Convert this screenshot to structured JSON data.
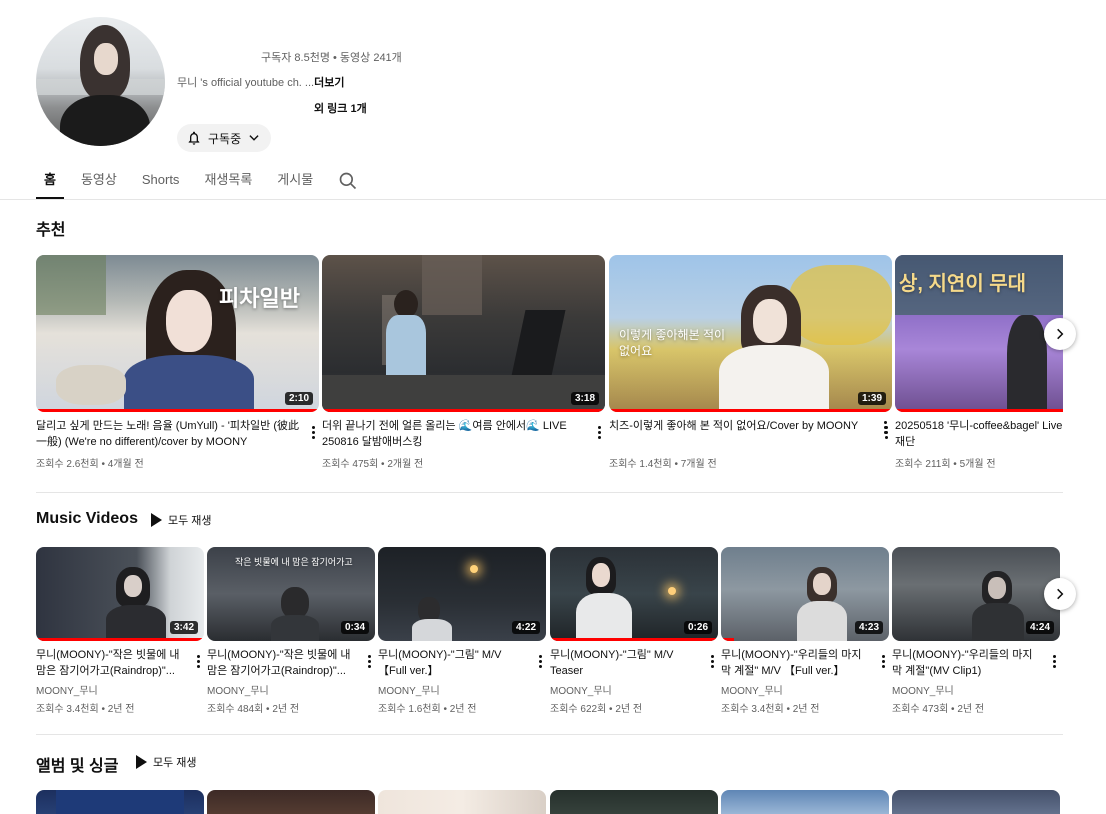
{
  "channel": {
    "subscribers": "구독자 8.5천명 • 동영상 241개",
    "description": "무니 's official youtube ch. ...",
    "more_label": "더보기",
    "links": "외 링크 1개",
    "subscribe_label": "구독중"
  },
  "tabs": [
    {
      "label": "홈",
      "active": true
    },
    {
      "label": "동영상"
    },
    {
      "label": "Shorts"
    },
    {
      "label": "재생목록"
    },
    {
      "label": "게시물"
    }
  ],
  "shelves": {
    "recommended": {
      "title": "추천",
      "videos": [
        {
          "title": "달리고 싶게 만드는 노래! 음율 (UmYull) - '피차일반 (彼此一般) (We're no different)/cover by MOONY",
          "meta": "조회수 2.6천회 • 4개월 전",
          "duration": "2:10",
          "overlay": "피차일반",
          "progress": 1.0
        },
        {
          "title": "더위 끝나기 전에 얼른 올리는 🌊여름 안에서🌊 LIVE 250816 달밤애버스킹",
          "meta": "조회수 475회 • 2개월 전",
          "duration": "3:18",
          "progress": 1.0
        },
        {
          "title": "치즈-이렇게 좋아해 본 적이 없어요/Cover by MOONY",
          "meta": "조회수 1.4천회 • 7개월 전",
          "duration": "1:39",
          "overlay": "이렇게 좋아해본 적이 없어요",
          "progress": 1.0
        },
        {
          "title": "20250518 '무니-coffee&bagel' Live 재단",
          "meta": "조회수 211회 • 5개월 전",
          "overlay": "상, 지연이 무대",
          "progress": 1.0
        }
      ]
    },
    "music_videos": {
      "title": "Music Videos",
      "play_all": "모두 재생",
      "videos": [
        {
          "title": "무니(MOONY)-\"작은 빗물에 내 맘은 잠기어가고(Raindrop)\"...",
          "channel": "MOONY_무니",
          "meta": "조회수 3.4천회 • 2년 전",
          "duration": "3:42",
          "progress": 1.0
        },
        {
          "title": "무니(MOONY)-\"작은 빗물에 내 맘은 잠기어가고(Raindrop)\"...",
          "channel": "MOONY_무니",
          "meta": "조회수 484회 • 2년 전",
          "duration": "0:34",
          "overlay": "작은 빗물에 내 맘은 잠기어가고",
          "progress": 0
        },
        {
          "title": "무니(MOONY)-\"그림\" M/V 【Full ver.】",
          "channel": "MOONY_무니",
          "meta": "조회수 1.6천회 • 2년 전",
          "duration": "4:22",
          "progress": 0
        },
        {
          "title": "무니(MOONY)-\"그림\" M/V Teaser",
          "channel": "MOONY_무니",
          "meta": "조회수 622회 • 2년 전",
          "duration": "0:26",
          "progress": 1.0
        },
        {
          "title": "무니(MOONY)-\"우리들의 마지막 계절\" M/V 【Full ver.】",
          "channel": "MOONY_무니",
          "meta": "조회수 3.4천회 • 2년 전",
          "duration": "4:23",
          "progress": 0.08
        },
        {
          "title": "무니(MOONY)-\"우리들의 마지막 계절\"(MV Clip1)",
          "channel": "MOONY_무니",
          "meta": "조회수 473회 • 2년 전",
          "duration": "4:24",
          "progress": 0
        }
      ]
    },
    "albums": {
      "title": "앨범 및 싱글",
      "play_all": "모두 재생"
    }
  },
  "icons": {
    "bell": "bell-icon",
    "chevron": "chevron-down-icon",
    "search": "search-icon",
    "next": "chevron-right-icon",
    "more": "more-vert-icon"
  }
}
